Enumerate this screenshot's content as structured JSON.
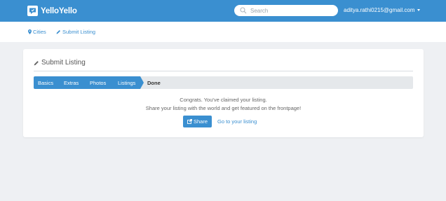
{
  "brand": {
    "name": "YelloYello"
  },
  "search": {
    "placeholder": "Search"
  },
  "user": {
    "email": "aditya.rathi0215@gmail.com"
  },
  "subnav": {
    "cities": "Cities",
    "submit_listing": "Submit Listing"
  },
  "card": {
    "title": "Submit Listing"
  },
  "steps": [
    {
      "label": "Basics",
      "state": "complete"
    },
    {
      "label": "Extras",
      "state": "complete"
    },
    {
      "label": "Photos",
      "state": "complete"
    },
    {
      "label": "Listings",
      "state": "complete"
    },
    {
      "label": "Done",
      "state": "current"
    }
  ],
  "message": {
    "line1": "Congrats. You've claimed your listing.",
    "line2": "Share your listing with the world and get featured on the frontpage!"
  },
  "actions": {
    "share": "Share",
    "go_to_listing": "Go to your listing"
  },
  "icons": {
    "brand": "chat-bubble-icon",
    "search": "search-icon",
    "cities": "map-marker-icon",
    "submit": "pencil-icon",
    "share": "share-icon"
  },
  "colors": {
    "primary": "#3a8fd0",
    "background": "#eef0f3",
    "step_inactive": "#e5e8eb"
  }
}
